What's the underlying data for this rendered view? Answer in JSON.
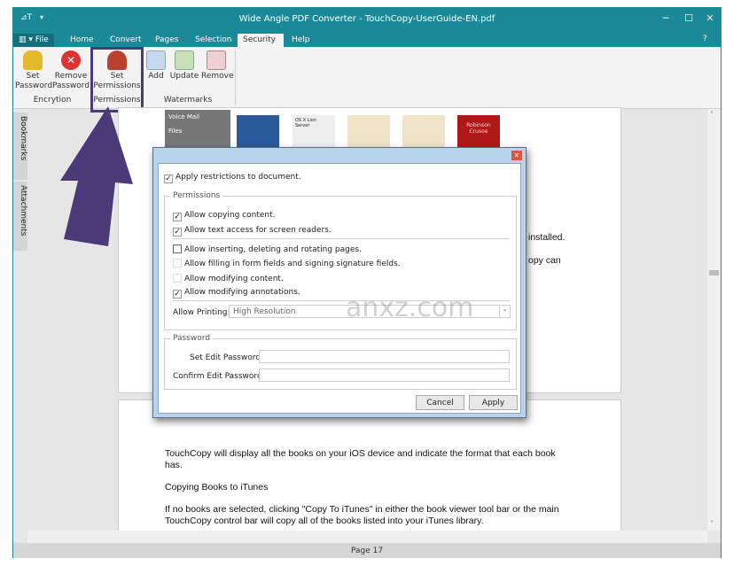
{
  "window": {
    "title": "Wide Angle PDF Converter - TouchCopy-UserGuide-EN.pdf",
    "accent": "#1a8a98"
  },
  "tabs": [
    {
      "label": "File"
    },
    {
      "label": "Home"
    },
    {
      "label": "Convert"
    },
    {
      "label": "Pages"
    },
    {
      "label": "Selection"
    },
    {
      "label": "Security",
      "active": true
    },
    {
      "label": "Help"
    }
  ],
  "ribbon": {
    "encryption": {
      "group": "Encrytion",
      "set": [
        "Set",
        "Password"
      ],
      "remove": [
        "Remove",
        "Password"
      ]
    },
    "permissions": {
      "group": "Permissions",
      "set": [
        "Set",
        "Permissions"
      ]
    },
    "watermarks": {
      "group": "Watermarks",
      "add": "Add",
      "update": "Update",
      "remove": "Remove"
    }
  },
  "sidebar": {
    "bookmarks": "Bookmarks",
    "attachments": "Attachments"
  },
  "thumbs": {
    "voicemail": "Voice Mail",
    "files": "Files",
    "t3": "OS X Lion Server",
    "t6": "Robinson Crusoe"
  },
  "page1": {
    "frag1": "installed.",
    "frag2": "opy can"
  },
  "page2": {
    "p1": "TouchCopy will display all the books on your iOS device and indicate the format that each book has.",
    "h": "Copying Books to iTunes",
    "p2": "If no books are selected, clicking \"Copy To iTunes\" in either the book viewer tool bar or the main TouchCopy control bar will copy all of the books listed into your iTunes library."
  },
  "status": {
    "page": "Page 17"
  },
  "dialog": {
    "apply_restrictions": {
      "label": "Apply restrictions to document.",
      "checked": true
    },
    "permissions_legend": "Permissions",
    "perms": [
      {
        "label": "Allow copying content.",
        "checked": true
      },
      {
        "label": "Allow text access for screen readers.",
        "checked": true
      },
      {
        "label": "Allow inserting, deleting and rotating pages.",
        "checked": false
      },
      {
        "label": "Allow filling in form fields and signing signature fields.",
        "checked": false
      },
      {
        "label": "Allow modifying content.",
        "checked": false
      },
      {
        "label": "Allow modifying annotations.",
        "checked": true
      }
    ],
    "printing_label": "Allow Printing:",
    "printing_value": "High Resolution",
    "password_legend": "Password",
    "set_pw": "Set Edit Password:",
    "confirm_pw": "Confirm Edit Password:",
    "set_pw_value": "",
    "confirm_pw_value": "",
    "cancel": "Cancel",
    "apply": "Apply"
  },
  "watermark_text": "anxz.com"
}
